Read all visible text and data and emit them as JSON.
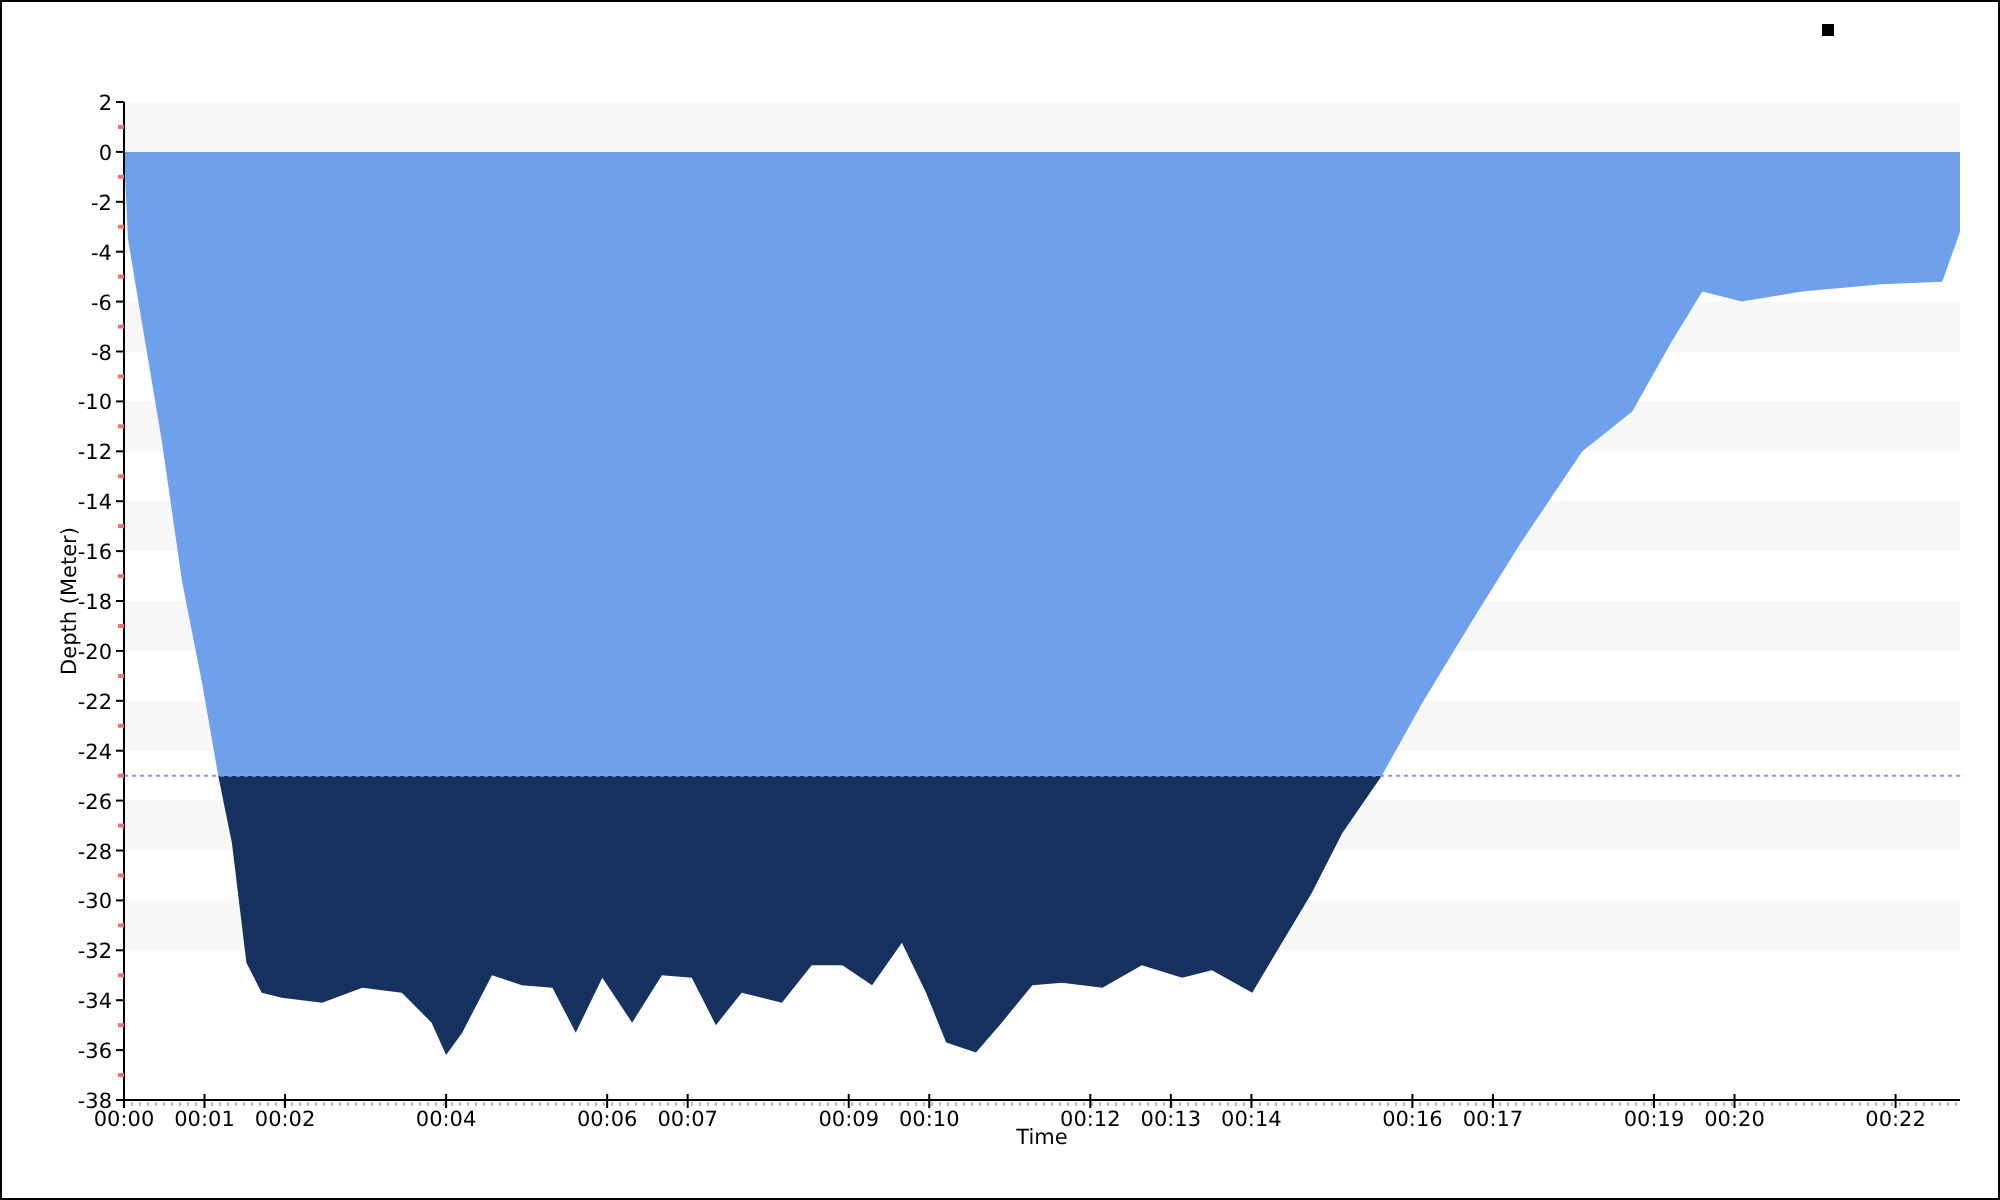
{
  "chart_data": {
    "type": "area",
    "xlabel": "Time",
    "ylabel": "Depth (Meter)",
    "x": [
      0,
      0.05,
      0.22,
      0.47,
      0.72,
      0.97,
      1.17,
      1.34,
      1.52,
      1.71,
      1.96,
      2.46,
      2.96,
      3.45,
      3.82,
      4.0,
      4.2,
      4.57,
      4.94,
      5.32,
      5.61,
      5.94,
      6.31,
      6.68,
      7.05,
      7.35,
      7.67,
      8.17,
      8.54,
      8.92,
      9.29,
      9.66,
      9.96,
      10.21,
      10.58,
      10.9,
      11.28,
      11.65,
      12.15,
      12.64,
      13.14,
      13.51,
      14.01,
      14.38,
      14.75,
      15.13,
      15.62,
      16.12,
      16.74,
      17.36,
      18.11,
      18.73,
      19.22,
      19.6,
      20.09,
      20.84,
      21.83,
      22.58,
      22.8
    ],
    "series": [
      {
        "color": "#6fa0ec",
        "values": [
          0,
          -3.5,
          -6.8,
          -11.6,
          -17.2,
          -21.3,
          -25.0,
          -27.7,
          -32.5,
          -33.7,
          -33.9,
          -34.1,
          -33.5,
          -33.7,
          -34.9,
          -36.2,
          -35.3,
          -33.0,
          -33.4,
          -33.5,
          -35.3,
          -33.1,
          -34.9,
          -33.0,
          -33.1,
          -35.0,
          -33.7,
          -34.1,
          -32.6,
          -32.6,
          -33.4,
          -31.7,
          -33.7,
          -35.7,
          -36.1,
          -34.9,
          -33.4,
          -33.3,
          -33.5,
          -32.6,
          -33.1,
          -32.8,
          -33.7,
          -31.7,
          -29.7,
          -27.3,
          -25.0,
          -22.1,
          -18.8,
          -15.6,
          -12.0,
          -10.4,
          -7.6,
          -5.6,
          -6.0,
          -5.6,
          -5.3,
          -5.2,
          -3.2
        ]
      }
    ],
    "xlim": [
      0,
      22.8
    ],
    "ylim": [
      -38,
      2
    ],
    "xticks": [
      {
        "value": 0,
        "label": "00:00"
      },
      {
        "value": 1,
        "label": "00:01"
      },
      {
        "value": 2,
        "label": "00:02"
      },
      {
        "value": 4,
        "label": "00:04"
      },
      {
        "value": 6,
        "label": "00:06"
      },
      {
        "value": 7,
        "label": "00:07"
      },
      {
        "value": 9,
        "label": "00:09"
      },
      {
        "value": 10,
        "label": "00:10"
      },
      {
        "value": 12,
        "label": "00:12"
      },
      {
        "value": 13,
        "label": "00:13"
      },
      {
        "value": 14,
        "label": "00:14"
      },
      {
        "value": 16,
        "label": "00:16"
      },
      {
        "value": 17,
        "label": "00:17"
      },
      {
        "value": 19,
        "label": "00:19"
      },
      {
        "value": 20,
        "label": "00:20"
      },
      {
        "value": 22,
        "label": "00:22"
      }
    ],
    "yticks": [
      2,
      0,
      -2,
      -4,
      -6,
      -8,
      -10,
      -12,
      -14,
      -16,
      -18,
      -20,
      -22,
      -24,
      -26,
      -28,
      -30,
      -32,
      -34,
      -36,
      -38
    ],
    "ref_lines": [
      {
        "axis": "y",
        "value": -25
      }
    ]
  }
}
